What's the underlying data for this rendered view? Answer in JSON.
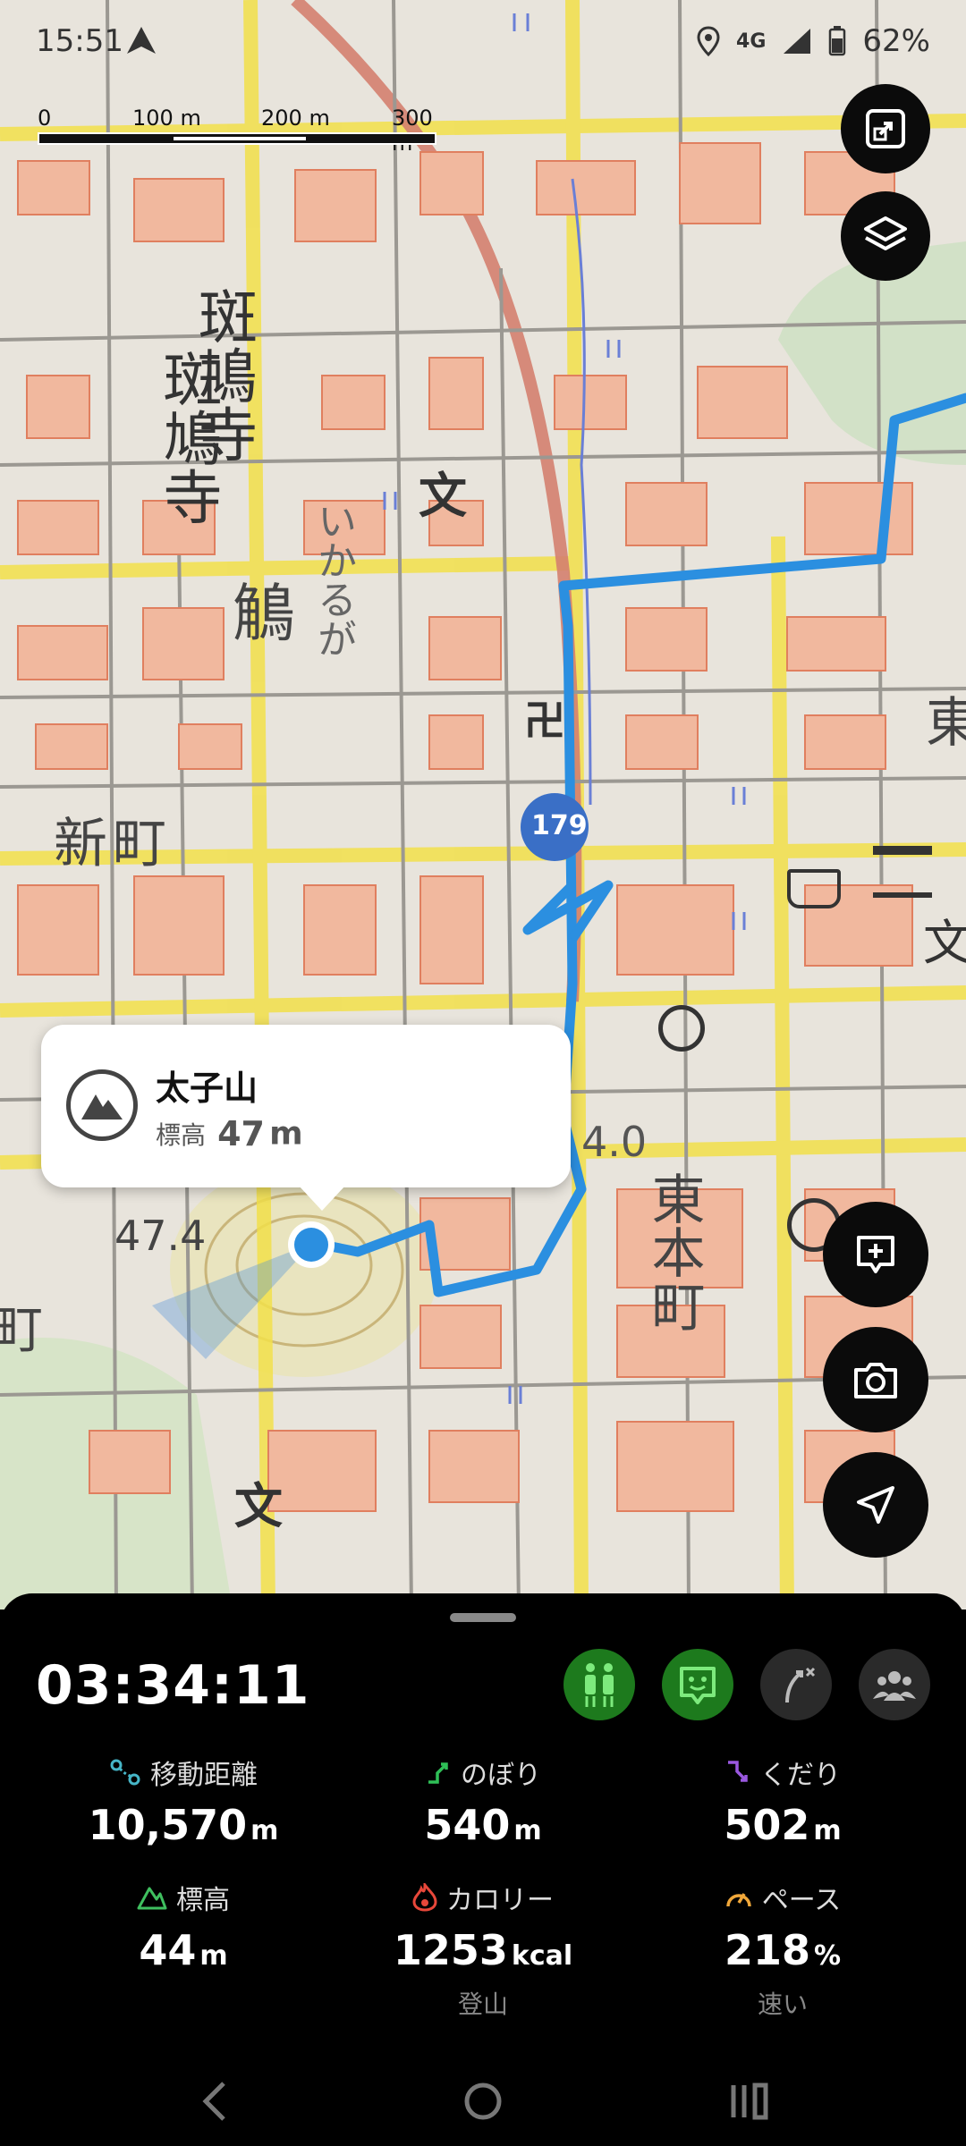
{
  "status_bar": {
    "time": "15:51",
    "network": "4G",
    "battery": "62%"
  },
  "scale_bar": {
    "labels": [
      "0",
      "100 m",
      "200 m",
      "300 m"
    ]
  },
  "map_labels": {
    "temple_name": "斑鳩寺",
    "town_ikaruga": "いかるが",
    "kanji_ikaru": "鵤",
    "shinmachi": "新町",
    "higashimoto": "東本町",
    "east": "東",
    "route_number": "179",
    "spot_height": "47.4",
    "contour_val": "4.0",
    "school_symbol": "文",
    "shrine_symbol": "卍",
    "machi": "町"
  },
  "popup": {
    "name": "太子山",
    "elevation_label": "標高",
    "elevation_value": "47",
    "elevation_unit": "m"
  },
  "tracker": {
    "elapsed": "03:34:11",
    "stats": [
      {
        "label": "移動距離",
        "value": "10,570",
        "unit": "m",
        "icon": "distance-icon",
        "color": "#46b6c8"
      },
      {
        "label": "のぼり",
        "value": "540",
        "unit": "m",
        "icon": "ascent-icon",
        "color": "#2fbf57"
      },
      {
        "label": "くだり",
        "value": "502",
        "unit": "m",
        "icon": "descent-icon",
        "color": "#9a58e0"
      },
      {
        "label": "標高",
        "value": "44",
        "unit": "m",
        "icon": "elevation-icon",
        "color": "#3fbf5f"
      },
      {
        "label": "カロリー",
        "value": "1253",
        "unit": "kcal",
        "icon": "flame-icon",
        "color": "#e8473a",
        "sub": "登山"
      },
      {
        "label": "ペース",
        "value": "218",
        "unit": "%",
        "icon": "speedometer-icon",
        "color": "#f0a73a",
        "sub": "速い"
      }
    ]
  },
  "colors": {
    "route": "#2b8fe0",
    "accent_green": "#2e9a2e",
    "sheet_bg": "#000000",
    "fab_bg": "#0b0b0b"
  }
}
